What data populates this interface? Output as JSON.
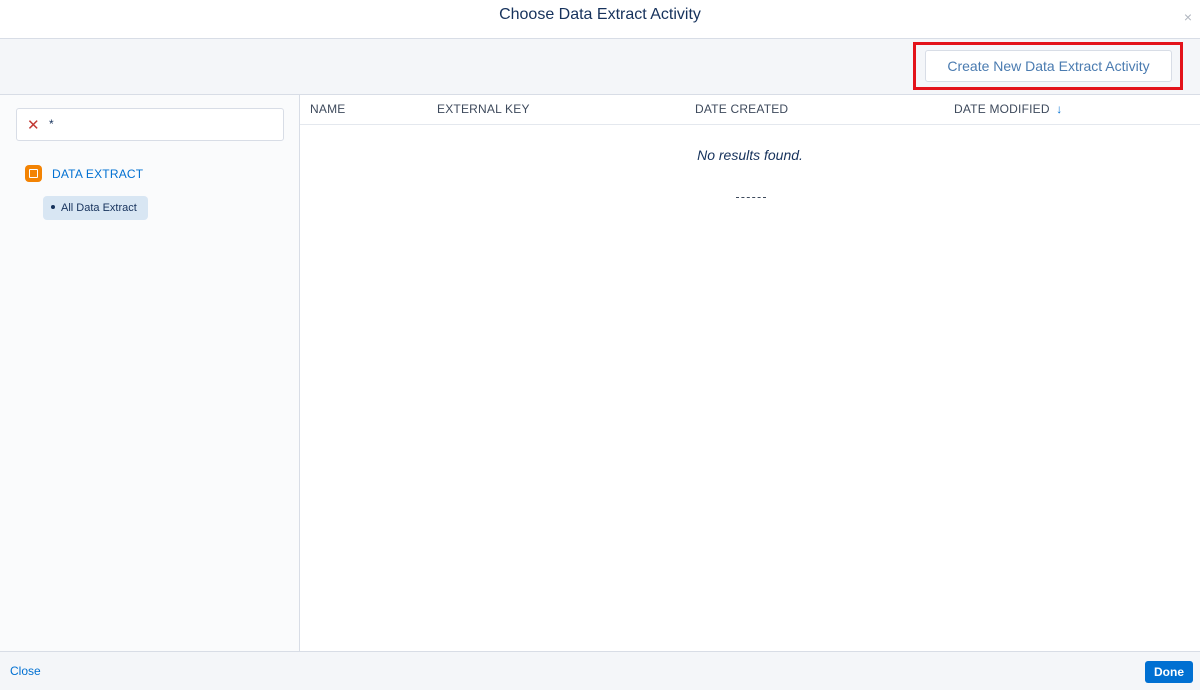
{
  "modal": {
    "title": "Choose Data Extract Activity",
    "close_glyph": "×"
  },
  "toolbar": {
    "create_label": "Create New Data Extract Activity"
  },
  "sidebar": {
    "search_value": "*",
    "clear_glyph": "✕",
    "folder_label": "DATA EXTRACT",
    "folder_icon": "data-extract-icon",
    "items": [
      {
        "label": "All Data Extract"
      }
    ]
  },
  "table": {
    "columns": [
      "NAME",
      "EXTERNAL KEY",
      "DATE CREATED",
      "DATE MODIFIED"
    ],
    "sort_glyph": "↓",
    "empty_text": "No results found."
  },
  "footer": {
    "close_label": "Close",
    "done_label": "Done"
  },
  "colors": {
    "accent": "#0070d2",
    "highlight": "#e3131b",
    "folder_icon": "#f38303"
  }
}
